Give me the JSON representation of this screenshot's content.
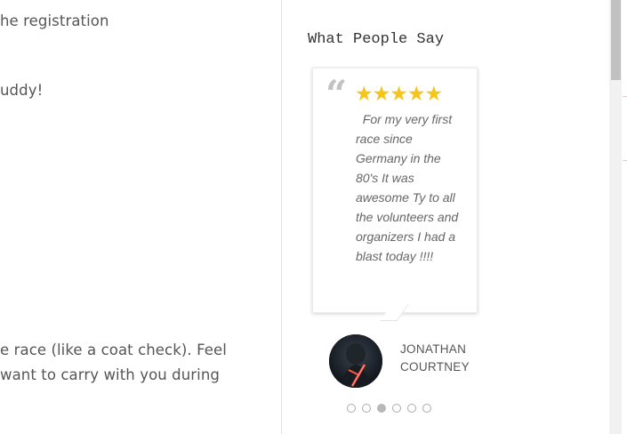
{
  "main": {
    "lines": [
      "he registration",
      "uddy!",
      "e race (like a coat check). Feel",
      "want to carry with you during"
    ]
  },
  "sidebar": {
    "top_partial": "",
    "widget_title": "What People Say",
    "testimonial": {
      "rating": 5,
      "stars": "★★★★★",
      "quote_glyph": "“",
      "text": "For my very first race since Germany in the 80's It was awesome Ty to all the volunteers and organizers I had a blast today !!!!",
      "author": "JONATHAN COURTNEY"
    },
    "carousel": {
      "slides": 6,
      "active_index": 2
    }
  },
  "colors": {
    "star": "#f5c518",
    "text": "#555555",
    "dot_active": "#b8b8b8"
  }
}
